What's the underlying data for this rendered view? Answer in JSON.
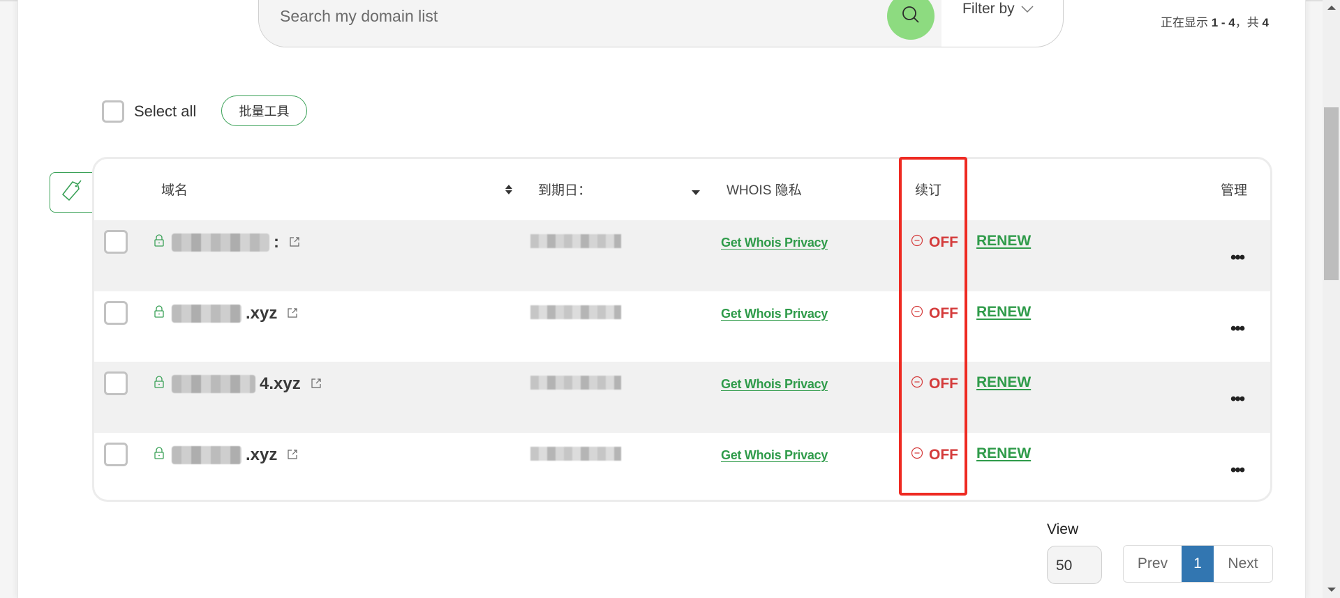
{
  "search": {
    "placeholder": "Search my domain list",
    "value": "",
    "search_icon": "search-icon",
    "filter_label": "Filter by",
    "filter_icon": "chevron-down-icon"
  },
  "results_summary": {
    "prefix": "正在显示",
    "range": "1 - 4",
    "separator": "，共",
    "total": "4"
  },
  "toolbar": {
    "select_all_label": "Select all",
    "select_all_checked": false,
    "bulk_tools_label": "批量工具",
    "tag_icon": "tag-icon"
  },
  "table": {
    "columns": [
      {
        "label": "域名",
        "sort_icon": "sort-both-icon"
      },
      {
        "label": "到期日：",
        "sort_icon": "sort-down-icon"
      },
      {
        "label": "WHOIS 隐私"
      },
      {
        "label": "续订"
      },
      {
        "label": "管理"
      }
    ],
    "rows": [
      {
        "domain_suffix": ":",
        "domain_redacted": true,
        "expiry_redacted": true,
        "whois_link": "Get Whois Privacy",
        "auto_renew": "OFF",
        "renew_link": "RENEW",
        "more_label": "•••",
        "checked": false
      },
      {
        "domain_suffix": ".xyz",
        "domain_redacted": true,
        "expiry_redacted": true,
        "whois_link": "Get Whois Privacy",
        "auto_renew": "OFF",
        "renew_link": "RENEW",
        "more_label": "•••",
        "checked": false
      },
      {
        "domain_suffix": "4.xyz",
        "domain_redacted": true,
        "expiry_redacted": true,
        "whois_link": "Get Whois Privacy",
        "auto_renew": "OFF",
        "renew_link": "RENEW",
        "more_label": "•••",
        "checked": false
      },
      {
        "domain_suffix": ".xyz",
        "domain_redacted": true,
        "expiry_redacted": true,
        "whois_link": "Get Whois Privacy",
        "auto_renew": "OFF",
        "renew_link": "RENEW",
        "more_label": "•••",
        "checked": false
      }
    ]
  },
  "pagination": {
    "view_label": "View",
    "page_size": "50",
    "prev_label": "Prev",
    "current_page": "1",
    "next_label": "Next"
  },
  "colors": {
    "accent_green": "#2f9b4a",
    "search_button": "#8ddb80",
    "off_red": "#d43b3b",
    "highlight_red": "#ee2a22",
    "active_page": "#3276b1"
  }
}
